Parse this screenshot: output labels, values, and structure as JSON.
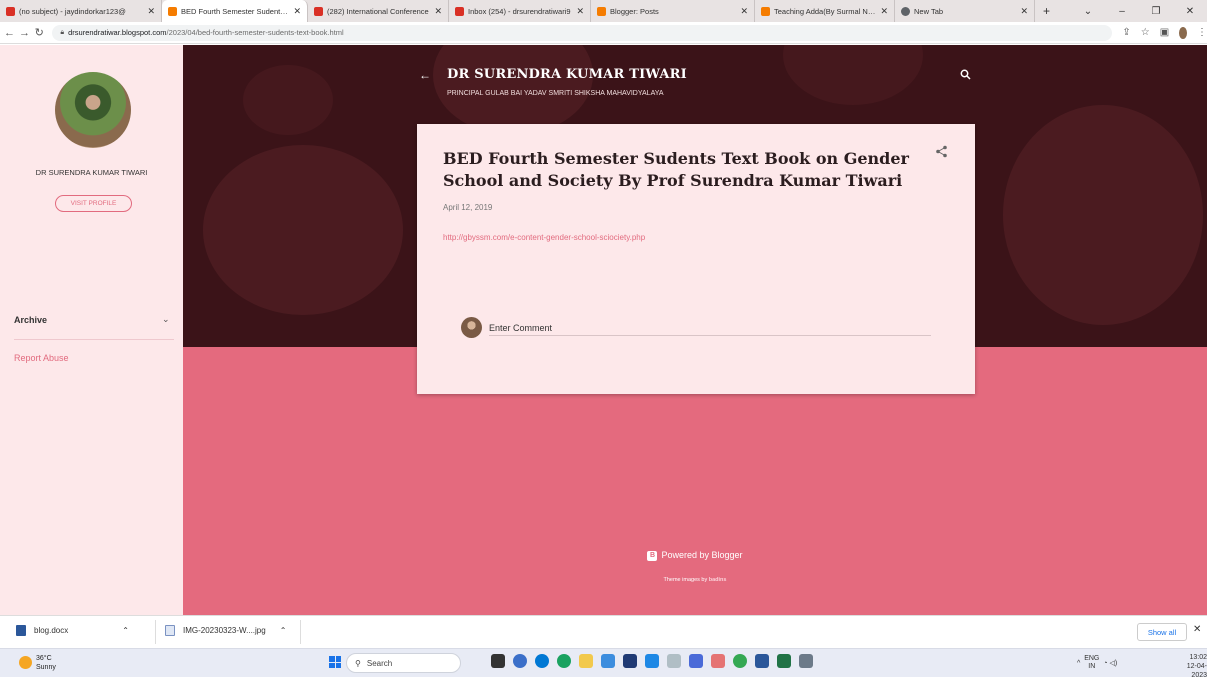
{
  "browser": {
    "tabs": [
      {
        "title": "(no subject) - jaydindorkar123@",
        "color": "#d93025"
      },
      {
        "title": "BED Fourth Semester Sudents Te",
        "color": "#f57c00",
        "active": true
      },
      {
        "title": "(282) International Conference",
        "color": "#d93025"
      },
      {
        "title": "Inbox (254) - drsurendratiwari9",
        "color": "#d93025"
      },
      {
        "title": "Blogger: Posts",
        "color": "#f57c00"
      },
      {
        "title": "Teaching Adda(By Surmal Narva",
        "color": "#f57c00"
      },
      {
        "title": "New Tab",
        "color": "#5f6368"
      }
    ],
    "url_domain": "drsurendratiwar.blogspot.com",
    "url_path": "/2023/04/bed-fourth-semester-sudents-text-book.html"
  },
  "sidebar": {
    "name": "DR SURENDRA KUMAR TIWARI",
    "visit_profile": "VISIT PROFILE",
    "archive": "Archive",
    "report_abuse": "Report Abuse"
  },
  "header": {
    "blog_title": "DR SURENDRA KUMAR TIWARI",
    "blog_subtitle": "PRINCIPAL GULAB BAI YADAV SMRITI SHIKSHA MAHAVIDYALAYA"
  },
  "post": {
    "title": "BED Fourth Semester Sudents Text Book on Gender School and Society By Prof Surendra Kumar Tiwari",
    "date": "April 12, 2019",
    "link": "http://gbyssm.com/e-content-gender-school-sciociety.php",
    "comment_placeholder": "Enter Comment"
  },
  "footer": {
    "powered": "Powered by Blogger",
    "theme_prefix": "Theme images by",
    "theme_author": "badins"
  },
  "downloads": {
    "item1": "blog.docx",
    "item2": "IMG-20230323-W....jpg",
    "show_all": "Show all"
  },
  "taskbar": {
    "temp": "36°C",
    "weather": "Sunny",
    "search": "Search",
    "lang1": "ENG",
    "lang2": "IN",
    "time": "13:02",
    "date": "12-04-2023"
  },
  "colors": {
    "accent": "#e46a7e",
    "hero": "#3b1318",
    "card": "#fde8ea"
  }
}
